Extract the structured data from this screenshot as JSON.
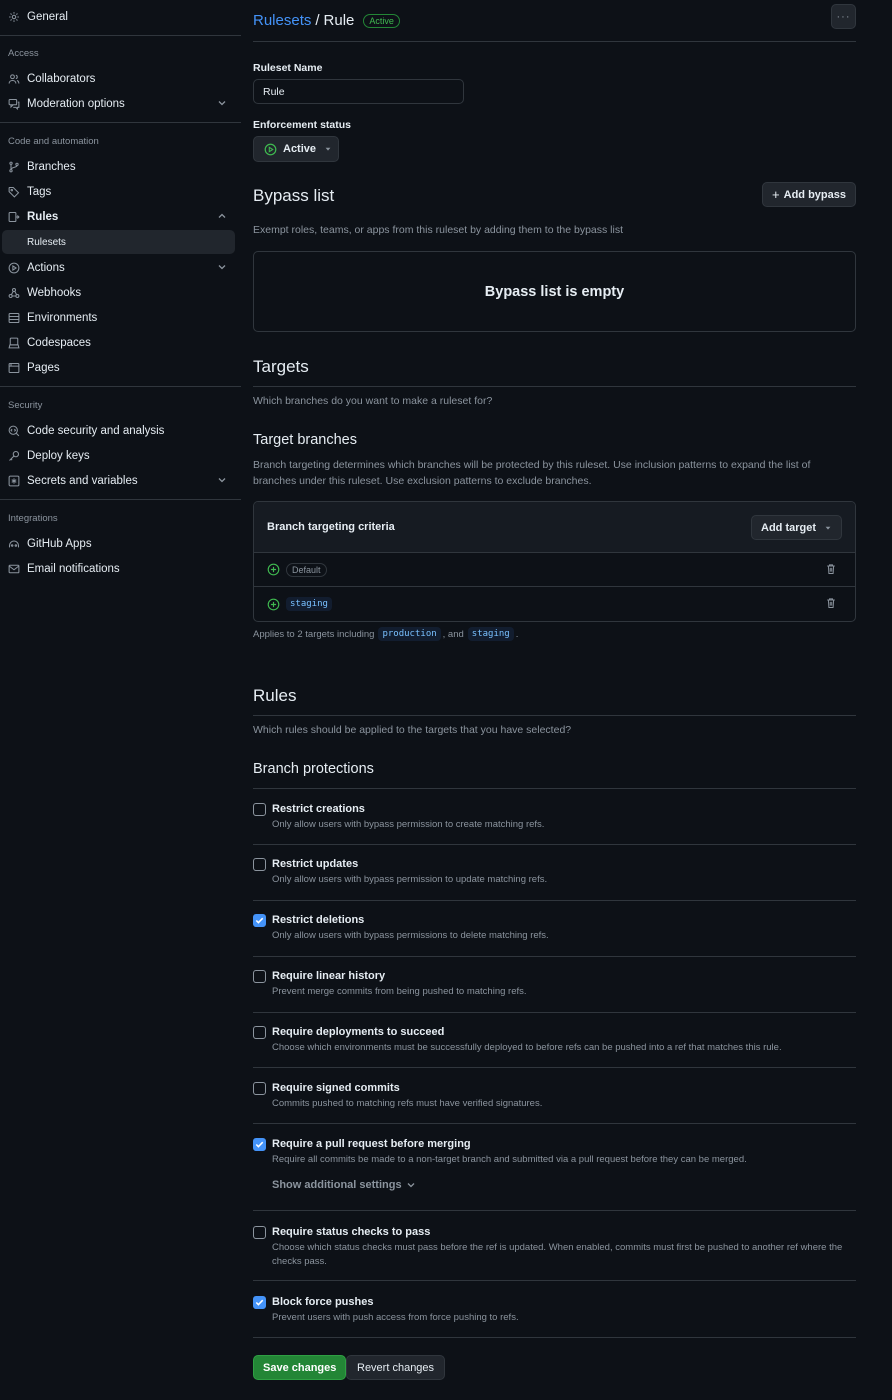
{
  "sidebar": {
    "general": "General",
    "sections": {
      "access": "Access",
      "code_automation": "Code and automation",
      "security": "Security",
      "integrations": "Integrations"
    },
    "items": {
      "collaborators": "Collaborators",
      "moderation": "Moderation options",
      "branches": "Branches",
      "tags": "Tags",
      "rules": "Rules",
      "rulesets": "Rulesets",
      "actions": "Actions",
      "webhooks": "Webhooks",
      "environments": "Environments",
      "codespaces": "Codespaces",
      "pages": "Pages",
      "code_security": "Code security and analysis",
      "deploy_keys": "Deploy keys",
      "secrets": "Secrets and variables",
      "github_apps": "GitHub Apps",
      "email_notifications": "Email notifications"
    }
  },
  "header": {
    "breadcrumb": "Rulesets",
    "separator": "/",
    "name": "Rule",
    "status": "Active",
    "kebab": "···"
  },
  "form": {
    "name_label": "Ruleset Name",
    "name_value": "Rule",
    "enforcement_label": "Enforcement status",
    "enforcement_value": "Active"
  },
  "bypass": {
    "title": "Bypass list",
    "add_button": "Add bypass",
    "description": "Exempt roles, teams, or apps from this ruleset by adding them to the bypass list",
    "empty": "Bypass list is empty"
  },
  "targets": {
    "title": "Targets",
    "description": "Which branches do you want to make a ruleset for?",
    "branches_title": "Target branches",
    "branches_description": "Branch targeting determines which branches will be protected by this ruleset. Use inclusion patterns to expand the list of branches under this ruleset. Use exclusion patterns to exclude branches.",
    "criteria_title": "Branch targeting criteria",
    "add_target": "Add target",
    "rows": [
      "Default",
      "staging"
    ],
    "applies_prefix": "Applies to 2 targets including",
    "applies_t1": "production",
    "applies_sep": ", and",
    "applies_t2": "staging",
    "applies_end": "."
  },
  "rules": {
    "title": "Rules",
    "description": "Which rules should be applied to the targets that you have selected?",
    "protections_title": "Branch protections",
    "items": [
      {
        "title": "Restrict creations",
        "desc": "Only allow users with bypass permission to create matching refs.",
        "checked": false
      },
      {
        "title": "Restrict updates",
        "desc": "Only allow users with bypass permission to update matching refs.",
        "checked": false
      },
      {
        "title": "Restrict deletions",
        "desc": "Only allow users with bypass permissions to delete matching refs.",
        "checked": true
      },
      {
        "title": "Require linear history",
        "desc": "Prevent merge commits from being pushed to matching refs.",
        "checked": false
      },
      {
        "title": "Require deployments to succeed",
        "desc": "Choose which environments must be successfully deployed to before refs can be pushed into a ref that matches this rule.",
        "checked": false
      },
      {
        "title": "Require signed commits",
        "desc": "Commits pushed to matching refs must have verified signatures.",
        "checked": false
      },
      {
        "title": "Require a pull request before merging",
        "desc": "Require all commits be made to a non-target branch and submitted via a pull request before they can be merged.",
        "checked": true
      },
      {
        "title": "Require status checks to pass",
        "desc": "Choose which status checks must pass before the ref is updated. When enabled, commits must first be pushed to another ref where the checks pass.",
        "checked": false
      },
      {
        "title": "Block force pushes",
        "desc": "Prevent users with push access from force pushing to refs.",
        "checked": true
      }
    ],
    "show_additional": "Show additional settings"
  },
  "footer": {
    "save": "Save changes",
    "revert": "Revert changes"
  },
  "colors": {
    "background": "#0d1117",
    "accent": "#4493f8",
    "success": "#238636",
    "border": "#30363d"
  }
}
